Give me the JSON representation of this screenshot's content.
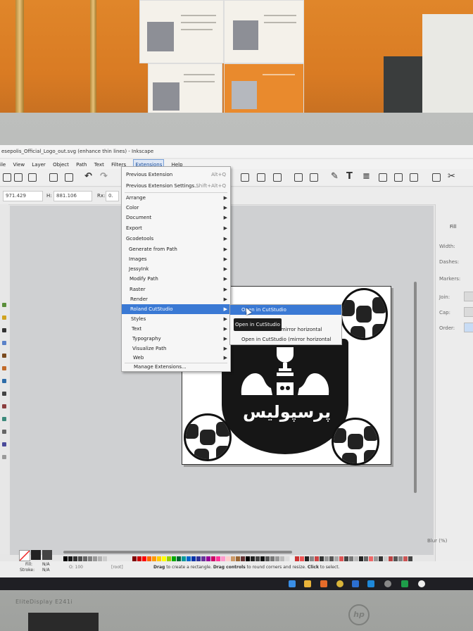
{
  "window": {
    "title": "esepolis_Official_Logo_out.svg (enhance thin lines) - Inkscape"
  },
  "menubar": {
    "items": [
      "ile",
      "View",
      "Layer",
      "Object",
      "Path",
      "Text",
      "Filters",
      "Extensions",
      "Help"
    ],
    "active": "Extensions"
  },
  "controls": {
    "x_value": "971.429",
    "h_label": "H:",
    "h_value": "881.106",
    "rx_label": "Rx:",
    "rx_value": "0."
  },
  "extensions_menu": {
    "previous_extension": "Previous Extension",
    "previous_extension_shortcut": "Alt+Q",
    "previous_settings": "Previous Extension Settings...",
    "previous_settings_shortcut": "Shift+Alt+Q",
    "items": [
      "Arrange",
      "Color",
      "Document",
      "Export",
      "Gcodetools",
      "Generate from Path",
      "Images",
      "JessyInk",
      "Modify Path",
      "Raster",
      "Render",
      "Roland CutStudio",
      "Styles",
      "Text",
      "Typography",
      "Visualize Path",
      "Web"
    ],
    "highlighted": "Roland CutStudio",
    "manage": "Manage Extensions..."
  },
  "cutstudio_submenu": {
    "items": [
      "Open in CutStudio",
      "Open in CutStudio (mirror horizontal)",
      "Open in CutStudio (mirror horizontal)"
    ],
    "visible_item2_suffix": "mirror horizontal",
    "visible_item3": "Open in CutStudio (mirror horizontal"
  },
  "tooltip": "Open in CutStudio",
  "artwork": {
    "text": "پرسپولیس"
  },
  "right_panel": {
    "tab": "Fill",
    "labels": [
      "Width:",
      "Dashes:",
      "Markers:",
      "Join:",
      "Cap:",
      "Order:"
    ],
    "blur_label": "Blur (%)"
  },
  "status": {
    "fill_label": "Fill:",
    "fill_value": "N/A",
    "stroke_label": "Stroke:",
    "stroke_value": "N/A",
    "opacity": "O: 100",
    "layer": "[root]",
    "hint_bold1": "Drag",
    "hint_text1": " to create a rectangle. ",
    "hint_bold2": "Drag controls",
    "hint_text2": " to round corners and resize. ",
    "hint_bold3": "Click",
    "hint_text3": " to select."
  },
  "monitor": {
    "model_label": "EliteDisplay E241i",
    "brand": "hp"
  },
  "colors": {
    "highlight": "#3a79d4",
    "canvas": "#cfd0d2",
    "wall": "#d97b23"
  }
}
